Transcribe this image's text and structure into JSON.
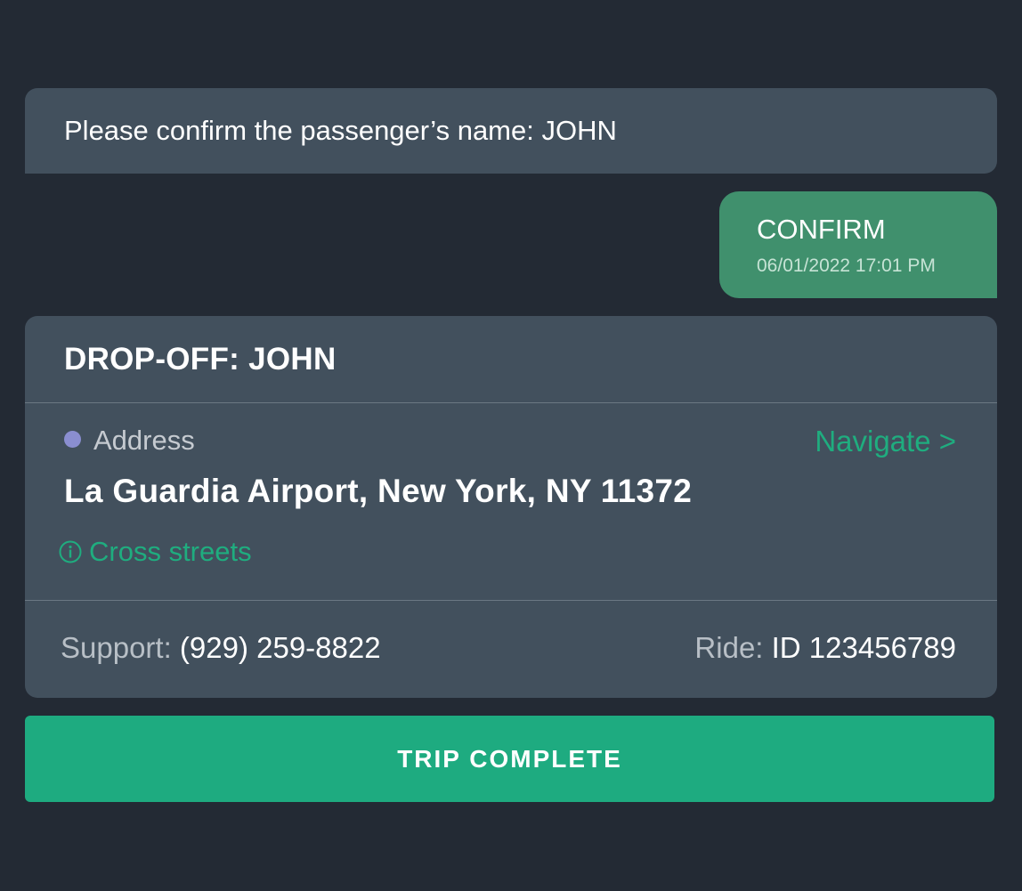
{
  "chat": {
    "prompt": "Please confirm the passenger’s name: JOHN",
    "reply": {
      "label": "CONFIRM",
      "timestamp": "06/01/2022 17:01 PM"
    }
  },
  "dropoff_card": {
    "title": "DROP-OFF: JOHN",
    "address_label": "Address",
    "navigate_label": "Navigate >",
    "address_value": "La Guardia Airport, New York, NY 11372",
    "cross_streets_label": "Cross streets",
    "support_label": "Support:",
    "support_phone": "(929) 259-8822",
    "ride_label": "Ride:",
    "ride_id": "ID 123456789"
  },
  "actions": {
    "trip_complete_label": "TRIP COMPLETE"
  },
  "icons": {
    "address_dot": "address-dot-icon",
    "info": "info-icon"
  },
  "colors": {
    "background": "#232a34",
    "card": "#42505d",
    "confirm_bubble": "#40906d",
    "accent_green": "#1fad7f",
    "address_dot": "#8a8ed0",
    "primary_button": "#1eab80"
  }
}
